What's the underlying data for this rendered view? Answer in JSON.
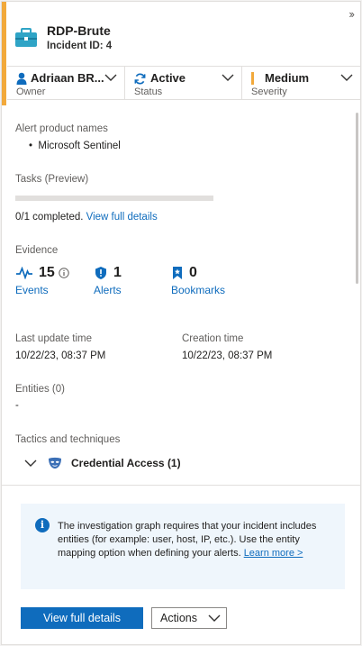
{
  "panel": {
    "title": "RDP-Brute",
    "incident_id": "Incident ID: 4",
    "accent_color": "#f2a93b",
    "icon": "briefcase-icon"
  },
  "meta": {
    "owner": {
      "value": "Adriaan BR...",
      "label": "Owner",
      "icon": "person-icon"
    },
    "status": {
      "value": "Active",
      "label": "Status",
      "icon": "refresh-icon"
    },
    "severity": {
      "value": "Medium",
      "label": "Severity",
      "color": "#f2a93b"
    }
  },
  "alert_products": {
    "label": "Alert product names",
    "items": [
      "Microsoft Sentinel"
    ]
  },
  "tasks": {
    "label": "Tasks (Preview)",
    "progress": 0,
    "completed_text": "0/1 completed.",
    "link": "View full details"
  },
  "evidence": {
    "label": "Evidence",
    "items": [
      {
        "count": "15",
        "label": "Events",
        "icon": "activity-icon"
      },
      {
        "count": "1",
        "label": "Alerts",
        "icon": "shield-icon"
      },
      {
        "count": "0",
        "label": "Bookmarks",
        "icon": "bookmark-icon"
      }
    ]
  },
  "times": {
    "last_update_label": "Last update time",
    "last_update_value": "10/22/23, 08:37 PM",
    "creation_label": "Creation time",
    "creation_value": "10/22/23, 08:37 PM"
  },
  "entities": {
    "label": "Entities (0)",
    "value": "-"
  },
  "tactics": {
    "label": "Tactics and techniques",
    "items": [
      {
        "name": "Credential Access (1)",
        "icon": "mask-icon"
      }
    ]
  },
  "info": {
    "text": "The investigation graph requires that your incident includes entities (for example: user, host, IP, etc.). Use the entity mapping option when defining your alerts. ",
    "link": "Learn more >"
  },
  "buttons": {
    "primary": "View full details",
    "secondary": "Actions"
  },
  "colors": {
    "brand": "#0f6cbd",
    "info_bg": "#eff6fc"
  }
}
